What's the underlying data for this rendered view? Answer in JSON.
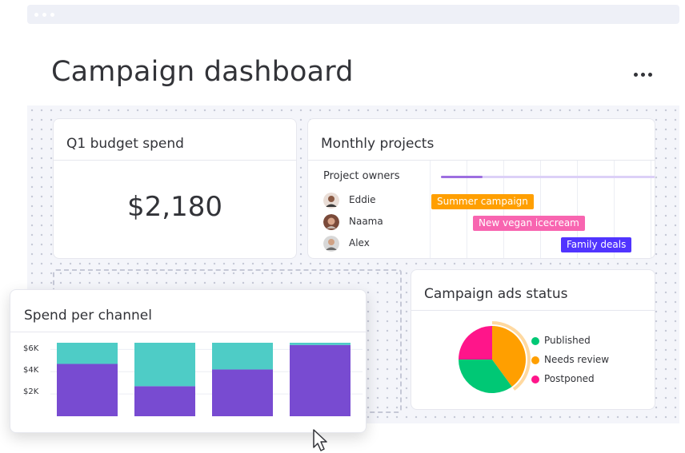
{
  "page": {
    "title": "Campaign dashboard"
  },
  "colors": {
    "purple": "#784bd1",
    "teal": "#4eccc6",
    "orange": "#ff9f00",
    "pink": "#f865b0",
    "green": "#00c875",
    "blue": "#5034ff",
    "magenta": "#ff158a"
  },
  "budget_card": {
    "title": "Q1 budget spend",
    "value": "$2,180"
  },
  "projects_card": {
    "title": "Monthly projects",
    "owners_label": "Project owners",
    "owners": [
      {
        "name": "Eddie",
        "avatar": "person-avatar"
      },
      {
        "name": "Naama",
        "avatar": "person-avatar"
      },
      {
        "name": "Alex",
        "avatar": "person-avatar"
      }
    ],
    "tasks": [
      {
        "label": "Summer campaign",
        "color": "#ff9f00"
      },
      {
        "label": "New vegan icecream",
        "color": "#f865b0"
      },
      {
        "label": "Family deals",
        "color": "#5034ff"
      }
    ]
  },
  "status_card": {
    "title": "Campaign ads status",
    "legend": [
      {
        "label": "Published",
        "color": "#00c875"
      },
      {
        "label": "Needs review",
        "color": "#ff9f00"
      },
      {
        "label": "Postponed",
        "color": "#ff158a"
      }
    ]
  },
  "chart_data": [
    {
      "type": "bar",
      "title": "Spend per channel",
      "stacked": true,
      "categories": [
        "",
        "",
        "",
        ""
      ],
      "ylim": [
        0,
        6.6
      ],
      "ytick_labels": [
        "$6K",
        "$4K",
        "$2K"
      ],
      "ytick_values": [
        6,
        4,
        2
      ],
      "series": [
        {
          "values": [
            4.7,
            2.7,
            4.2,
            6.4
          ],
          "color": "#784bd1"
        },
        {
          "values": [
            1.9,
            3.9,
            2.4,
            0.2
          ],
          "color": "#4eccc6"
        }
      ]
    },
    {
      "type": "pie",
      "slices": [
        {
          "label": "Published",
          "value": 35,
          "color": "#00c875"
        },
        {
          "label": "Needs review",
          "value": 40,
          "color": "#ff9f00"
        },
        {
          "label": "Postponed",
          "value": 25,
          "color": "#ff158a"
        }
      ]
    }
  ]
}
